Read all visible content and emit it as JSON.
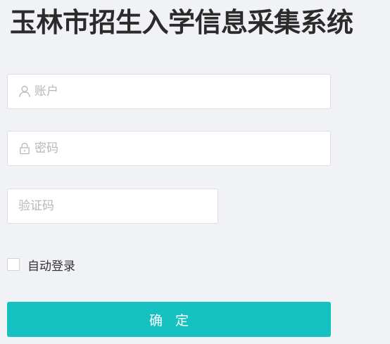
{
  "page": {
    "title": "玉林市招生入学信息采集系统"
  },
  "form": {
    "account": {
      "placeholder": "账户",
      "value": "",
      "icon": "user-icon"
    },
    "password": {
      "placeholder": "密码",
      "value": "",
      "icon": "lock-icon"
    },
    "captcha": {
      "placeholder": "验证码",
      "value": ""
    },
    "remember": {
      "label": "自动登录",
      "checked": false
    },
    "submit_label": "确 定"
  },
  "colors": {
    "background": "#f0f2f6",
    "accent": "#15c1c1",
    "input_border": "#dcdfe6",
    "placeholder": "#b5b7bc"
  }
}
